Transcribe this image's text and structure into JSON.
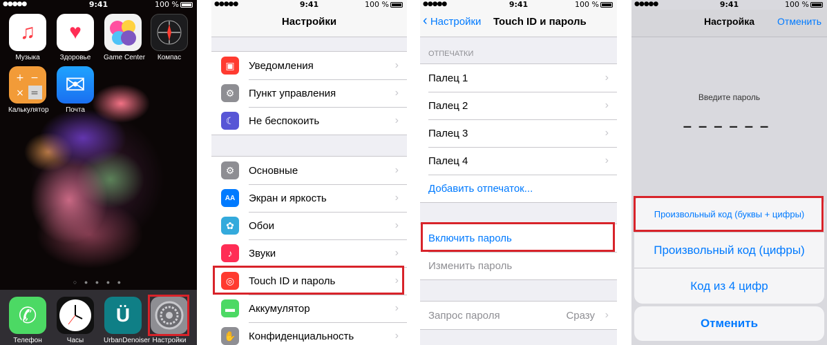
{
  "status": {
    "time": "9:41",
    "battery": "100 %"
  },
  "home": {
    "apps": [
      {
        "label": "Музыка",
        "icon": "music-note-icon",
        "glyph": "♫",
        "bg": "#ffffff",
        "fg": "#fc3c44"
      },
      {
        "label": "Здоровье",
        "icon": "heart-icon",
        "glyph": "♥",
        "bg": "#ffffff",
        "fg": "#ff2d55"
      },
      {
        "label": "Game Center",
        "icon": "game-center-icon",
        "glyph": "●",
        "bg": "#f0f0f0",
        "fg": "#8e44ad"
      },
      {
        "label": "Компас",
        "icon": "compass-icon",
        "glyph": "✛",
        "bg": "#1c1c1e",
        "fg": "#ffffff"
      },
      {
        "label": "Калькулятор",
        "icon": "calculator-icon",
        "glyph": "±",
        "bg": "#f29b38",
        "fg": "#ffffff"
      },
      {
        "label": "Почта",
        "icon": "mail-icon",
        "glyph": "✉",
        "bg": "#1e8cf5",
        "fg": "#ffffff"
      }
    ],
    "dock": [
      {
        "label": "Телефон",
        "icon": "phone-icon",
        "glyph": "✆",
        "bg": "#4cd964",
        "fg": "#ffffff"
      },
      {
        "label": "Часы",
        "icon": "clock-icon",
        "glyph": "◷",
        "bg": "#ffffff",
        "fg": "#000000"
      },
      {
        "label": "UrbanDenoiser",
        "icon": "urbandenoiser-icon",
        "glyph": "Ü",
        "bg": "#0f7f86",
        "fg": "#ffffff"
      },
      {
        "label": "Настройки",
        "icon": "settings-gear-icon",
        "glyph": "⚙",
        "bg": "#8e8e93",
        "fg": "#dddddd"
      }
    ]
  },
  "settings": {
    "title": "Настройки",
    "group1": [
      {
        "label": "Уведомления",
        "icon": "notifications-icon",
        "glyph": "■",
        "bg": "#ff3b30"
      },
      {
        "label": "Пункт управления",
        "icon": "control-center-icon",
        "glyph": "⚙",
        "bg": "#8e8e93"
      },
      {
        "label": "Не беспокоить",
        "icon": "moon-icon",
        "glyph": "☾",
        "bg": "#5856d6"
      }
    ],
    "group2": [
      {
        "label": "Основные",
        "icon": "gear-icon",
        "glyph": "⚙",
        "bg": "#8e8e93"
      },
      {
        "label": "Экран и яркость",
        "icon": "display-brightness-icon",
        "glyph": "AA",
        "bg": "#007aff"
      },
      {
        "label": "Обои",
        "icon": "wallpaper-icon",
        "glyph": "✿",
        "bg": "#34aadc"
      },
      {
        "label": "Звуки",
        "icon": "speaker-icon",
        "glyph": "♪",
        "bg": "#ff2d55"
      },
      {
        "label": "Touch ID и пароль",
        "icon": "fingerprint-icon",
        "glyph": "◎",
        "bg": "#ff3b30"
      },
      {
        "label": "Аккумулятор",
        "icon": "battery-icon",
        "glyph": "▬",
        "bg": "#4cd964"
      },
      {
        "label": "Конфиденциальность",
        "icon": "privacy-hand-icon",
        "glyph": "✋",
        "bg": "#8e8e93"
      }
    ]
  },
  "touchid": {
    "back": "Настройки",
    "title": "Touch ID и пароль",
    "section_header": "ОТПЕЧАТКИ",
    "fingers": [
      "Палец 1",
      "Палец 2",
      "Палец 3",
      "Палец 4"
    ],
    "add_fingerprint": "Добавить отпечаток...",
    "enable_passcode": "Включить пароль",
    "change_passcode": "Изменить пароль",
    "require_passcode": "Запрос пароля",
    "require_value": "Сразу"
  },
  "passcode": {
    "title": "Настройка",
    "cancel_nav": "Отменить",
    "prompt": "Введите пароль",
    "options": [
      "Произвольный код (буквы + цифры)",
      "Произвольный код (цифры)",
      "Код из 4 цифр"
    ],
    "cancel": "Отменить"
  },
  "colors": {
    "accent": "#007aff",
    "highlight": "#d8232a"
  }
}
